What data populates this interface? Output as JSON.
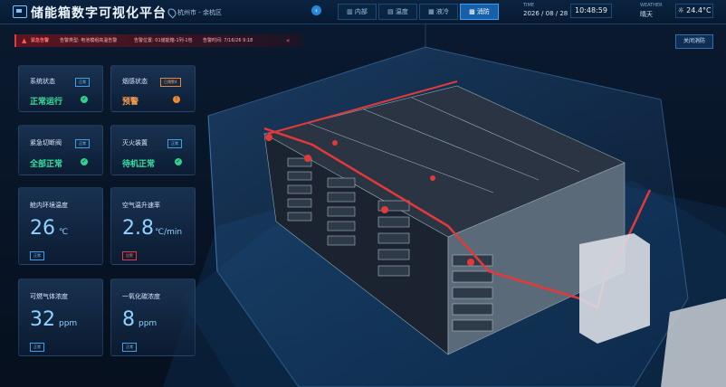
{
  "header": {
    "title": "储能箱数字可视化平台",
    "location": "杭州市 - 余杭区",
    "tabs": [
      {
        "label": "▥ 内部"
      },
      {
        "label": "▤ 温度"
      },
      {
        "label": "▦ 液冷"
      },
      {
        "label": "▩ 消防"
      }
    ],
    "time_label": "TIME",
    "date": "2026 / 08 / 28",
    "clock": "10:48:59",
    "weather_label": "WEATHER",
    "weather": "晴天",
    "temperature": "☼ 24.4°C"
  },
  "alert": {
    "level": "紧急告警",
    "content1": "告警类型: 电池模组高温告警",
    "content2": "告警位置: 01储能箱-1列-1包",
    "content3": "告警时间: 7/16/26 9:18",
    "arrows": "«"
  },
  "close_fire_label": "关闭消防",
  "cards": {
    "system": {
      "label": "系统状态",
      "tag": "正常",
      "value": "正常运行"
    },
    "smoke": {
      "label": "烟感状态",
      "tag": "已预警4",
      "value": "预警"
    },
    "emergency": {
      "label": "紧急切断阀",
      "tag": "正常",
      "value": "全部正常"
    },
    "extinguish": {
      "label": "灭火装置",
      "tag": "正常",
      "value": "待机正常"
    },
    "inner_temp": {
      "label": "舱内环境温度",
      "value": "26",
      "unit": "℃",
      "state": "正常"
    },
    "air_rise": {
      "label": "空气温升速率",
      "value": "2.8",
      "unit": "℃/min",
      "state": "告警"
    },
    "gas": {
      "label": "可燃气体浓度",
      "value": "32",
      "unit": "ppm",
      "state": "正常"
    },
    "co": {
      "label": "一氧化碳浓度",
      "value": "8",
      "unit": "ppm",
      "state": "正常"
    }
  },
  "colors": {
    "ok": "#31d18e",
    "warn": "#f08a3a",
    "alert": "#e63b3b",
    "accent": "#1560a8"
  }
}
